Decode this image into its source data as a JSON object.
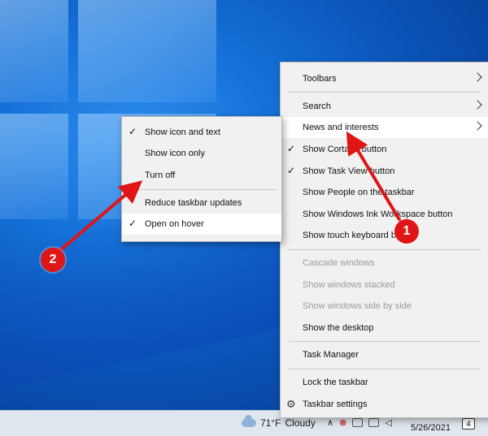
{
  "main_menu": {
    "items": [
      {
        "label": "Toolbars",
        "submenu": true
      },
      {
        "label": "Search",
        "submenu": true
      },
      {
        "label": "News and interests",
        "submenu": true,
        "highlighted": true
      },
      {
        "label": "Show Cortana button",
        "checked": true
      },
      {
        "label": "Show Task View button",
        "checked": true
      },
      {
        "label": "Show People on the taskbar"
      },
      {
        "label": "Show Windows Ink Workspace button"
      },
      {
        "label": "Show touch keyboard button"
      },
      {
        "label": "Cascade windows",
        "disabled": true
      },
      {
        "label": "Show windows stacked",
        "disabled": true
      },
      {
        "label": "Show windows side by side",
        "disabled": true
      },
      {
        "label": "Show the desktop"
      },
      {
        "label": "Task Manager"
      },
      {
        "label": "Lock the taskbar"
      },
      {
        "label": "Taskbar settings",
        "icon": "gear-icon"
      }
    ]
  },
  "submenu": {
    "items": [
      {
        "label": "Show icon and text",
        "checked": true
      },
      {
        "label": "Show icon only"
      },
      {
        "label": "Turn off"
      },
      {
        "label": "Reduce taskbar updates"
      },
      {
        "label": "Open on hover",
        "checked": true,
        "highlighted": true
      }
    ]
  },
  "annotations": {
    "badge1": "1",
    "badge2": "2",
    "color": "#e01515"
  },
  "taskbar": {
    "weather_temp": "71°F",
    "weather_desc": "Cloudy",
    "date": "5/26/2021",
    "notification_count": "4"
  }
}
